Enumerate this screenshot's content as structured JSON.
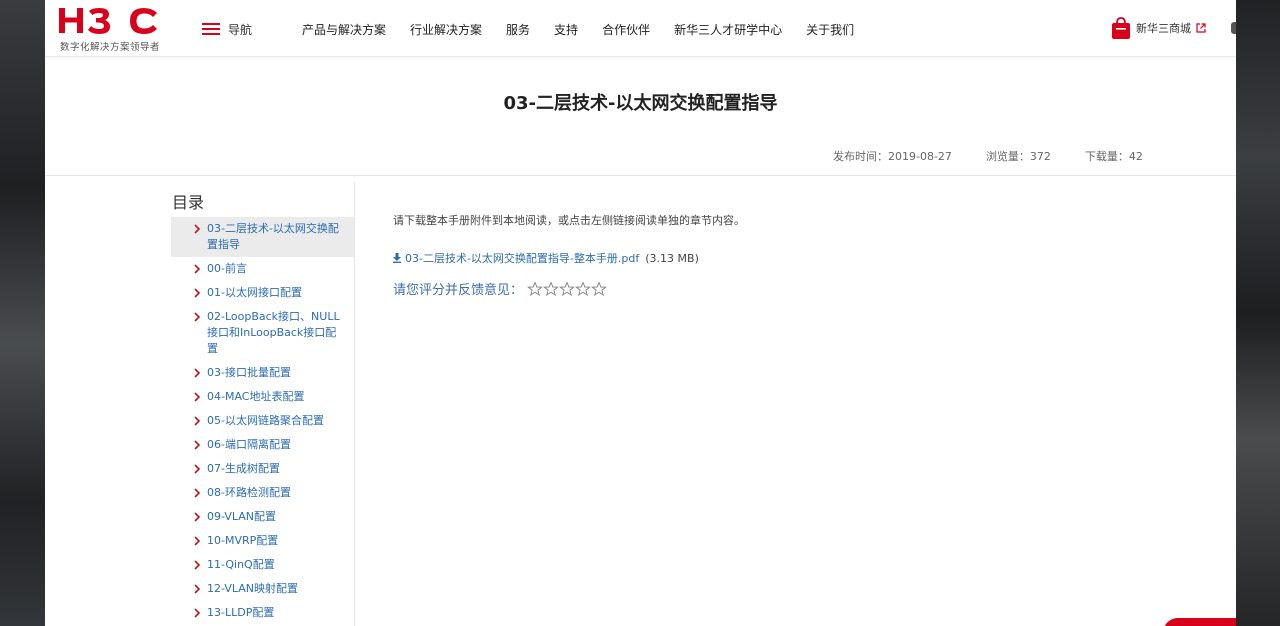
{
  "brand": {
    "name": "H3C",
    "tagline": "数字化解决方案领导者",
    "color": "#d9001b"
  },
  "nav": {
    "toggle_label": "导航",
    "items": [
      "产品与解决方案",
      "行业解决方案",
      "服务",
      "支持",
      "合作伙伴",
      "新华三人才研学中心",
      "关于我们"
    ],
    "shop_label": "新华三商城"
  },
  "document": {
    "title": "03-二层技术-以太网交换配置指导",
    "publish_label": "发布时间：2019-08-27",
    "views_label": "浏览量：372",
    "downloads_label": "下载量：42"
  },
  "toc": {
    "title": "目录",
    "items": [
      {
        "label": "03-二层技术-以太网交换配置指导",
        "active": true
      },
      {
        "label": "00-前言"
      },
      {
        "label": "01-以太网接口配置"
      },
      {
        "label": "02-LoopBack接口、NULL接口和InLoopBack接口配置"
      },
      {
        "label": "03-接口批量配置"
      },
      {
        "label": "04-MAC地址表配置"
      },
      {
        "label": "05-以太网链路聚合配置"
      },
      {
        "label": "06-端口隔离配置"
      },
      {
        "label": "07-生成树配置"
      },
      {
        "label": "08-环路检测配置"
      },
      {
        "label": "09-VLAN配置"
      },
      {
        "label": "10-MVRP配置"
      },
      {
        "label": "11-QinQ配置"
      },
      {
        "label": "12-VLAN映射配置"
      },
      {
        "label": "13-LLDP配置"
      }
    ]
  },
  "content": {
    "intro": "请下载整本手册附件到本地阅读，或点击左侧链接阅读单独的章节内容。",
    "download_link": "03-二层技术-以太网交换配置指导-整本手册.pdf",
    "download_size": "(3.13 MB)",
    "rating_label": "请您评分并反馈意见：",
    "rating_value": 0,
    "rating_max": 5
  }
}
